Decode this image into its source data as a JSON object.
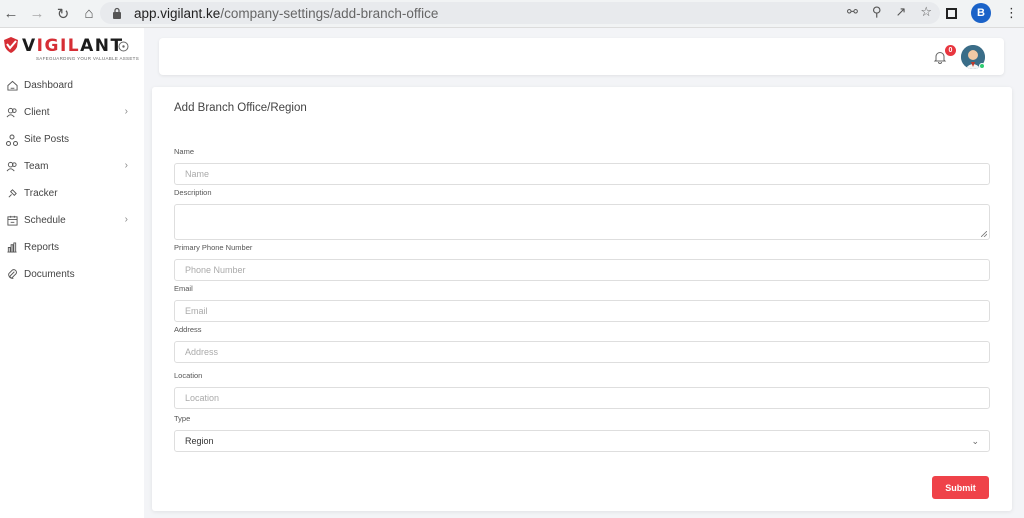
{
  "browser": {
    "url_domain": "app.vigilant.ke",
    "url_path": "/company-settings/add-branch-office",
    "profile_initial": "B"
  },
  "brand": {
    "name_prefix": "V",
    "name_accent": "IGIL",
    "name_suffix": "ANT",
    "tagline": "SAFEGUARDING YOUR VALUABLE ASSETS",
    "accent_color": "#d62e35"
  },
  "sidebar": {
    "items": [
      {
        "label": "Dashboard",
        "icon": "home-icon",
        "has_chevron": false
      },
      {
        "label": "Client",
        "icon": "users-icon",
        "has_chevron": true
      },
      {
        "label": "Site Posts",
        "icon": "network-icon",
        "has_chevron": false
      },
      {
        "label": "Team",
        "icon": "team-icon",
        "has_chevron": true
      },
      {
        "label": "Tracker",
        "icon": "pin-icon",
        "has_chevron": false
      },
      {
        "label": "Schedule",
        "icon": "calendar-icon",
        "has_chevron": true
      },
      {
        "label": "Reports",
        "icon": "chart-icon",
        "has_chevron": false
      },
      {
        "label": "Documents",
        "icon": "paperclip-icon",
        "has_chevron": false
      }
    ]
  },
  "header": {
    "notification_count": "0"
  },
  "form": {
    "title": "Add Branch Office/Region",
    "fields": {
      "name": {
        "label": "Name",
        "placeholder": "Name"
      },
      "description": {
        "label": "Description",
        "placeholder": ""
      },
      "phone": {
        "label": "Primary Phone Number",
        "placeholder": "Phone Number"
      },
      "email": {
        "label": "Email",
        "placeholder": "Email"
      },
      "address": {
        "label": "Address",
        "placeholder": "Address"
      },
      "location": {
        "label": "Location",
        "placeholder": "Location"
      },
      "type": {
        "label": "Type",
        "value": "Region"
      }
    },
    "submit_label": "Submit",
    "submit_color": "#ef4249"
  }
}
